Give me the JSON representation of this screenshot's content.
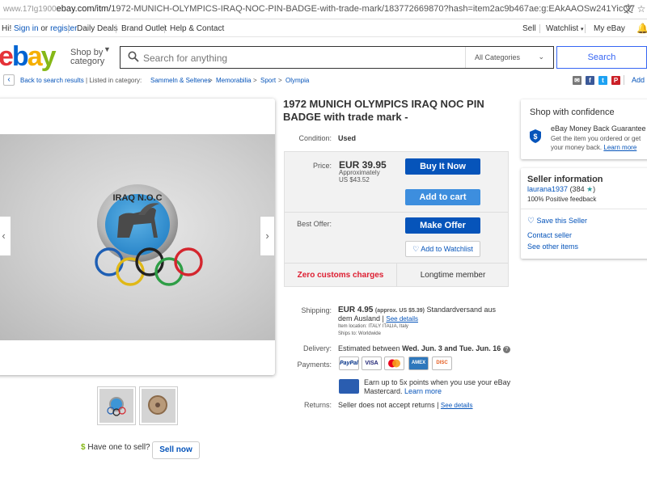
{
  "browser": {
    "url_prefix": "ebay.com/itm/",
    "url": "1972-MUNICH-OLYMPICS-IRAQ-NOC-PIN-BADGE-with-trade-mark/183772669870?hash=item2ac9b467ae:g:EAkAAOSw241YicQ7",
    "watermark": "www.17Ig1900"
  },
  "topnav": {
    "greeting": "Hi!",
    "sign_in": "Sign in",
    "or": "or",
    "register": "register",
    "daily_deals": "Daily Deals",
    "brand_outlet": "Brand Outlet",
    "help_contact": "Help & Contact",
    "sell": "Sell",
    "watchlist": "Watchlist",
    "my_ebay": "My eBay"
  },
  "header": {
    "logo": "ebay",
    "shop_by": "Shop by",
    "category": "category",
    "search_placeholder": "Search for anything",
    "all_categories": "All Categories",
    "search_button": "Search"
  },
  "breadcrumb": {
    "back": "Back to search results",
    "listed_in": "Listed in category:",
    "items": [
      "Sammeln & Seltenes",
      "Memorabilia",
      "Sport",
      "Olympia"
    ],
    "add": "Add"
  },
  "listing": {
    "title": "1972 MUNICH OLYMPICS IRAQ NOC PIN BADGE with trade mark -",
    "condition_label": "Condition:",
    "condition": "Used",
    "price_label": "Price:",
    "price": "EUR 39.95",
    "approx_label": "Approximately",
    "approx": "US $43.52",
    "buy_now": "Buy It Now",
    "add_to_cart": "Add to cart",
    "best_offer_label": "Best Offer:",
    "make_offer": "Make Offer",
    "add_to_watchlist": "Add to Watchlist",
    "zero_customs": "Zero customs charges",
    "longtime_member": "Longtime member",
    "shipping_label": "Shipping:",
    "shipping_price": "EUR 4.95",
    "shipping_approx": "(approx. US $5.39)",
    "shipping_method": "Standardversand aus",
    "shipping_from": "dem Ausland",
    "see_details": "See details",
    "item_location": "Item location: ITALY ITALIA, Italy",
    "ships_to": "Ships to: Worldwide",
    "delivery_label": "Delivery:",
    "delivery_pre": "Estimated between",
    "delivery_dates": "Wed. Jun. 3 and Tue. Jun. 16",
    "payments_label": "Payments:",
    "payment_methods": [
      "PayPal",
      "VISA",
      "MC",
      "AMEX",
      "DISC"
    ],
    "earn_points": "Earn up to 5x points when you use your eBay",
    "mastercard": "Mastercard.",
    "learn_more": "Learn more",
    "returns_label": "Returns:",
    "returns": "Seller does not accept returns",
    "returns_see": "See details",
    "badge_text": "IRAQ N.O.C",
    "have_one": "Have one to sell?",
    "sell_now": "Sell now"
  },
  "sidebar": {
    "shop_confidence": "Shop with confidence",
    "guarantee_title": "eBay Money Back Guarantee",
    "guarantee_text": "Get the item you ordered or get",
    "guarantee_text2": "your money back.",
    "learn_more": "Learn more",
    "seller_info": "Seller information",
    "seller_name": "laurana1937",
    "feedback_count": "(384",
    "positive": "100% Positive feedback",
    "save_seller": "Save this Seller",
    "contact_seller": "Contact seller",
    "see_other": "See other items"
  },
  "colors": {
    "ebay_red": "#e53238",
    "ebay_blue": "#0064d2",
    "ebay_yellow": "#f5af02",
    "ebay_green": "#86b817",
    "link": "#0654ba",
    "button": "#0654ba",
    "customs_red": "#dd1e31"
  }
}
